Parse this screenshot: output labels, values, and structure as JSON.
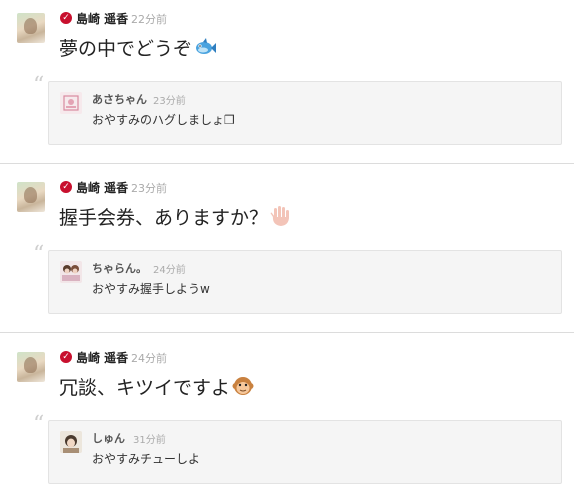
{
  "posts": [
    {
      "author": "島崎 遥香",
      "time": "22分前",
      "message": "夢の中でどうぞ",
      "emoji": "fish-emoji",
      "reply": {
        "author": "あさちゃん",
        "time": "23分前",
        "text": "おやすみのハグしましょ❒"
      }
    },
    {
      "author": "島崎 遥香",
      "time": "23分前",
      "message": "握手会券、ありますか？",
      "emoji": "raised-hand-emoji",
      "reply": {
        "author": "ちゃらん。",
        "time": "24分前",
        "text": "おやすみ握手しようw"
      }
    },
    {
      "author": "島崎 遥香",
      "time": "24分前",
      "message": "冗談、キツイですよ",
      "emoji": "monkey-emoji",
      "reply": {
        "author": "しゅん",
        "time": "31分前",
        "text": "おやすみチューしよ"
      }
    }
  ],
  "colors": {
    "verified": "#c8102e",
    "time": "#aaaaaa",
    "reply_bg": "#f5f5f5"
  }
}
